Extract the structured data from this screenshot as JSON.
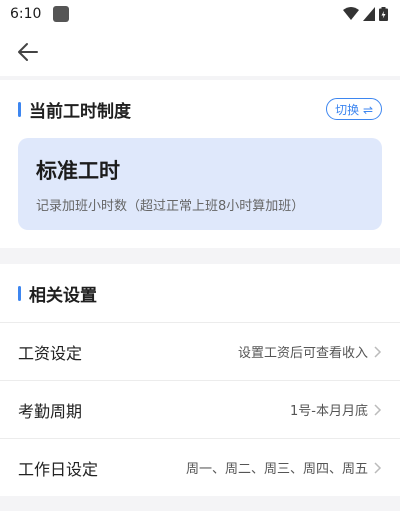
{
  "status_bar": {
    "time": "6:10"
  },
  "header": {
    "back_icon": "arrow-left-icon"
  },
  "current_schedule": {
    "section_title": "当前工时制度",
    "switch_label": "切换 ⇌",
    "name": "标准工时",
    "description": "记录加班小时数（超过正常上班8小时算加班）"
  },
  "settings": {
    "section_title": "相关设置",
    "items": [
      {
        "label": "工资设定",
        "value": "设置工资后可查看收入"
      },
      {
        "label": "考勤周期",
        "value": "1号-本月月底"
      },
      {
        "label": "工作日设定",
        "value": "周一、周二、周三、周四、周五"
      }
    ]
  },
  "colors": {
    "accent": "#3d86f0",
    "card_bg": "#dfe8fb",
    "page_bg": "#f4f4f6"
  }
}
